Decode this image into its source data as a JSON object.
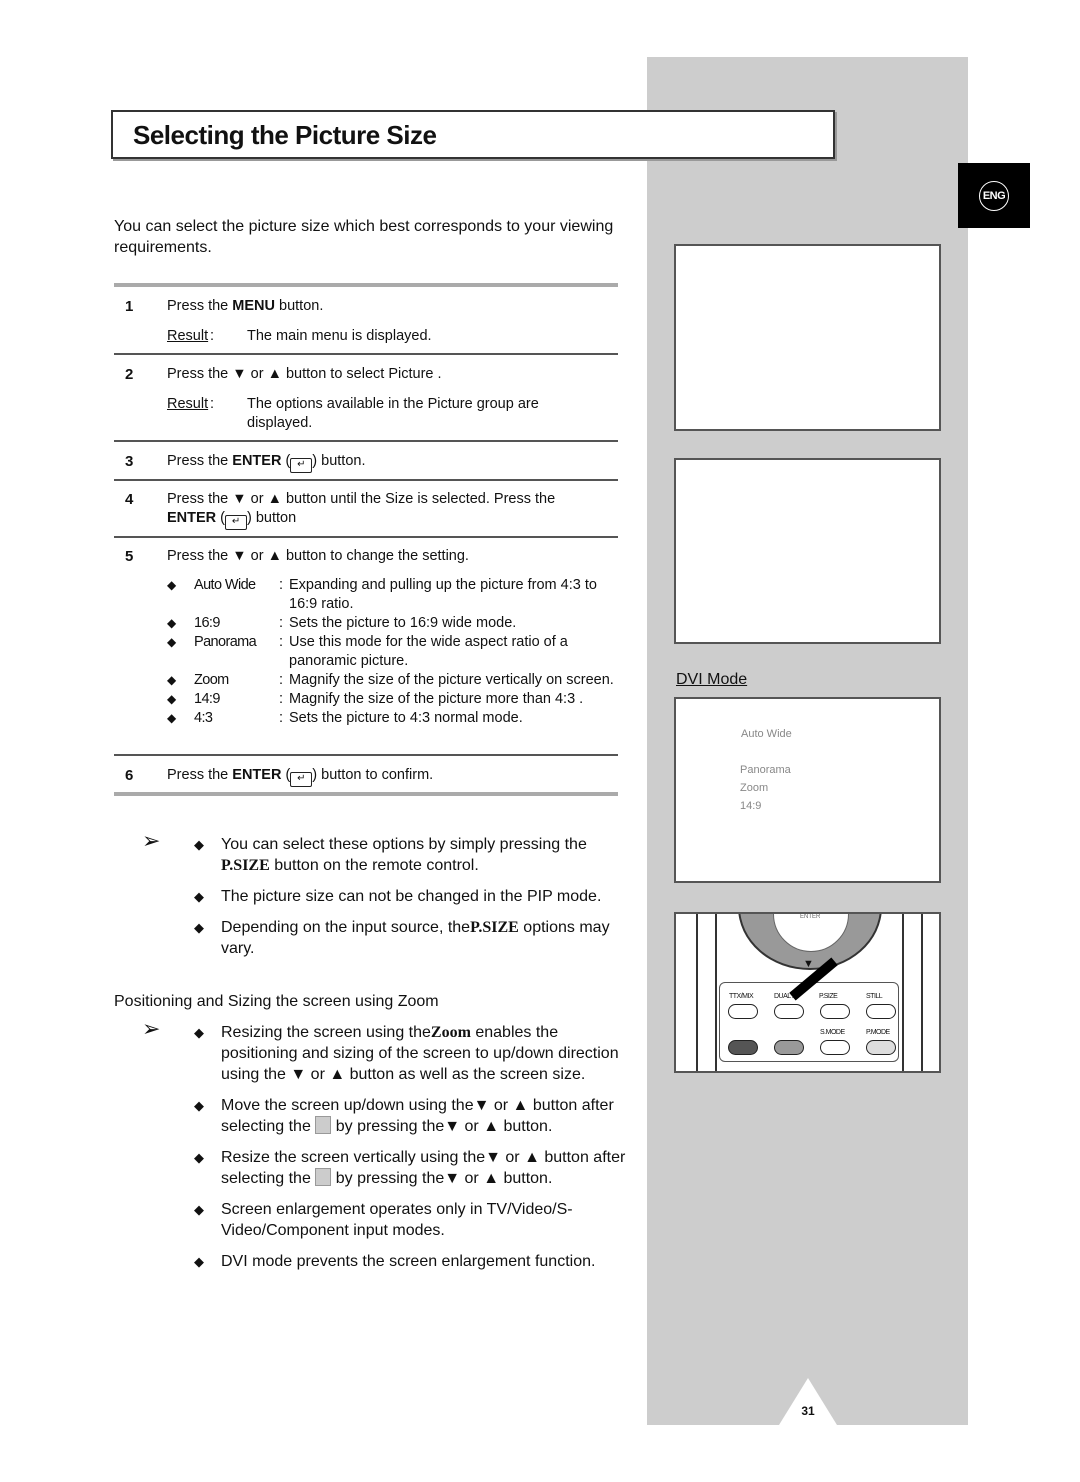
{
  "title": "Selecting the Picture Size",
  "badge": "ENG",
  "intro": "You can select the picture size which best corresponds to your viewing requirements.",
  "steps": [
    {
      "num": "1",
      "pre": "Press the ",
      "bold": "MENU",
      "post": " button.",
      "result_label": "Result",
      "result": "The main menu is displayed."
    },
    {
      "num": "2",
      "text": "Press the ▼ or ▲ button to select Picture   .",
      "result_label": "Result",
      "result": "The options available in the Picture    group are displayed."
    },
    {
      "num": "3",
      "pre": "Press the ",
      "bold": "ENTER",
      "post": ") button."
    },
    {
      "num": "4",
      "text": "Press the ▼ or ▲ button until the Size  is selected. Press the",
      "bold": "ENTER",
      "post": ") button"
    },
    {
      "num": "5",
      "text": "Press the ▼ or ▲ button to change the setting."
    },
    {
      "num": "6",
      "pre": "Press the ",
      "bold": "ENTER",
      "post": ") button to confirm."
    }
  ],
  "options": [
    {
      "name": "Auto Wide",
      "desc": "Expanding and pulling up the picture from 4:3 to 16:9 ratio."
    },
    {
      "name": "16:9",
      "desc": "Sets the picture to 16:9 wide mode."
    },
    {
      "name": "Panorama",
      "desc": "Use this mode for the wide aspect ratio of a panoramic picture."
    },
    {
      "name": "Zoom",
      "desc": "Magnify the size of the picture vertically on screen."
    },
    {
      "name": "14:9",
      "desc": "Magnify the size of the picture more than 4:3 ."
    },
    {
      "name": "4:3",
      "desc": "Sets the picture to 4:3 normal mode."
    }
  ],
  "notes1": [
    {
      "pre": "You can select these options by simply pressing the ",
      "bold": "P.SIZE",
      "post": " button on the remote control."
    },
    {
      "pre": "The picture size can not be changed in the PIP mode."
    },
    {
      "pre": "Depending on the input source, the",
      "bold": "P.SIZE",
      "post": " options may vary."
    }
  ],
  "subheading": "Positioning and Sizing the screen using Zoom",
  "notes2": [
    {
      "pre": "Resizing the screen using the",
      "bold": "Zoom",
      "post": " enables the positioning and sizing of the screen to up/down direction using the ▼ or ▲ button as well as the screen size."
    },
    {
      "pre": "Move the screen up/down using the▼ or ▲ button after selecting the ",
      "post": "  by pressing the▼ or ▲ button."
    },
    {
      "pre": "Resize the screen vertically using the▼ or ▲ button after selecting the ",
      "post": "  by pressing the▼ or ▲ button."
    },
    {
      "pre": "Screen enlargement operates only in TV/Video/S-Video/Component input modes."
    },
    {
      "pre": "DVI mode prevents the screen enlargement function."
    }
  ],
  "dvi": {
    "label": "DVI Mode",
    "options": [
      "Auto Wide",
      "Panorama",
      "Zoom",
      "14:9"
    ]
  },
  "remote": {
    "enter": "ENTER",
    "labels": [
      "TTX/MIX",
      "DUAL I-II",
      "P.SIZE",
      "STILL",
      "S.MODE",
      "P.MODE"
    ]
  },
  "page_number": "31"
}
